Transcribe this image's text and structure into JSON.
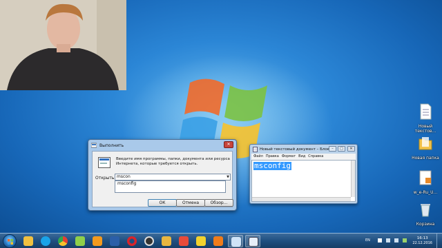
{
  "desktop_icons": [
    {
      "label_line1": "Новый",
      "label_line2": "текстов...",
      "icon": "text-document-icon"
    },
    {
      "label_line1": "Новая папка",
      "label_line2": "",
      "icon": "folder-icon"
    },
    {
      "label_line1": "w_e-Ru_U...",
      "label_line2": "",
      "icon": "installer-icon"
    },
    {
      "label_line1": "Корзина",
      "label_line2": "",
      "icon": "recycle-bin-icon"
    }
  ],
  "run_dialog": {
    "title": "Выполнить",
    "description": "Введите имя программы, папки, документа или ресурса Интернета, которые требуется открыть.",
    "open_label": "Открыть:",
    "input_value": "mscon",
    "suggestion": "msconfig",
    "ok_label": "ОК",
    "cancel_label": "Отмена",
    "browse_label": "Обзор..."
  },
  "notepad": {
    "title": "Новый текстовый документ – Блокнот",
    "menu": [
      "Файл",
      "Правка",
      "Формат",
      "Вид",
      "Справка"
    ],
    "content": "msconfig"
  },
  "taskbar": {
    "apps": [
      "explorer-icon",
      "skype-icon",
      "chrome-icon",
      "notepad-plus-icon",
      "ok-icon",
      "word-icon",
      "opera-icon",
      "obs-icon",
      "folder-icon",
      "app-icon",
      "media-icon",
      "vlc-icon",
      "notepad-icon",
      "run-icon"
    ],
    "lang": "EN",
    "time": "16:13",
    "date": "22.12.2016"
  },
  "colors": {
    "accent": "#2b86d6",
    "selection": "#3399ff",
    "close": "#c7453b"
  }
}
